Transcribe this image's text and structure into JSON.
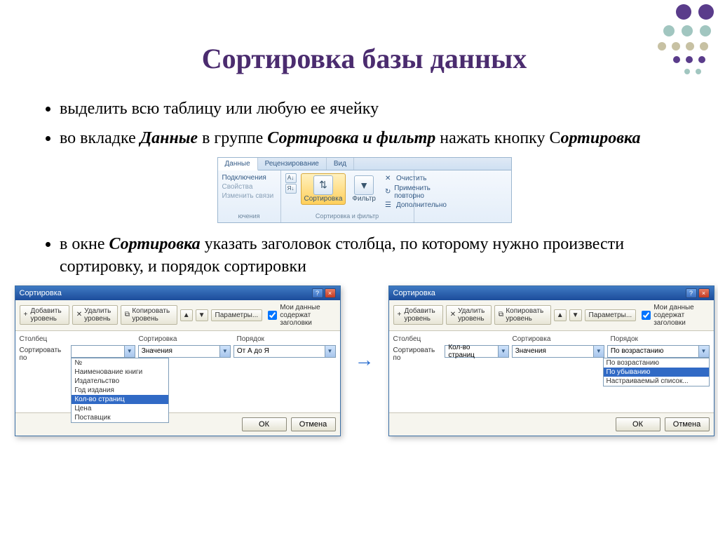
{
  "title": "Сортировка базы данных",
  "bullets": {
    "b1": "выделить всю таблицу или любую ее ячейку",
    "b2_pre": "во вкладке ",
    "b2_em1": "Данные",
    "b2_mid": " в группе ",
    "b2_em2": "Сортировка и фильтр",
    "b2_mid2": "  нажать кнопку С",
    "b2_em3": "ортировка",
    "b3_pre": "в окне ",
    "b3_em1": "Сортировка",
    "b3_rest": " указать заголовок столбца, по которому нужно произвести сортировку, и порядок сортировки"
  },
  "ribbon": {
    "tabs": {
      "t1": "Данные",
      "t2": "Рецензирование",
      "t3": "Вид"
    },
    "links": {
      "l1": "Подключения",
      "l2": "Свойства",
      "l3": "Изменить связи",
      "l4": "ючения"
    },
    "az": "А↓Я",
    "za": "Я↓А",
    "sort_label": "Сортировка",
    "filter_label": "Фильтр",
    "group_label": "Сортировка и фильтр",
    "opts": {
      "o1": "Очистить",
      "o2": "Применить повторно",
      "o3": "Дополнительно"
    }
  },
  "dialog": {
    "title": "Сортировка",
    "tb": {
      "add": "Добавить уровень",
      "del": "Удалить уровень",
      "copy": "Копировать уровень",
      "params": "Параметры...",
      "chk": "Мои данные содержат заголовки"
    },
    "head": {
      "c1": "Столбец",
      "c2": "Сортировка",
      "c3": "Порядок"
    },
    "row_label": "Сортировать по",
    "left": {
      "combo1": "",
      "combo2": "Значения",
      "combo3": "От А до Я",
      "options": [
        "№",
        "Наименование книги",
        "Издательство",
        "Год издания",
        "Кол-во страниц",
        "Цена",
        "Поставщик"
      ],
      "selected": "Кол-во страниц"
    },
    "right": {
      "combo1": "Кол-во страниц",
      "combo2": "Значения",
      "combo3": "По возрастанию",
      "options": [
        "По возрастанию",
        "По убыванию",
        "Настраиваемый список..."
      ],
      "selected": "По убыванию"
    },
    "ok": "ОК",
    "cancel": "Отмена"
  }
}
